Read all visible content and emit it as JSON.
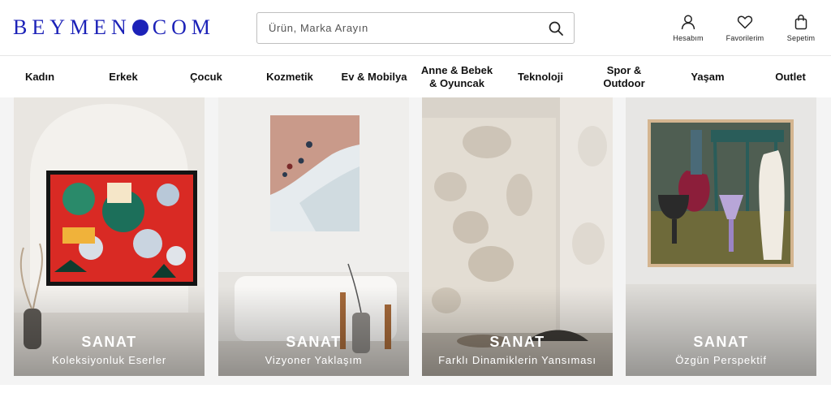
{
  "header": {
    "logo_text": {
      "left": "BEYMEN",
      "right": "COM"
    },
    "search": {
      "placeholder": "Ürün, Marka Arayın"
    },
    "actions": [
      {
        "label": "Hesabım",
        "icon": "user-icon"
      },
      {
        "label": "Favorilerim",
        "icon": "heart-icon"
      },
      {
        "label": "Sepetim",
        "icon": "shopping-bag-icon"
      }
    ]
  },
  "nav": {
    "items": [
      {
        "label": "Kadın"
      },
      {
        "label": "Erkek"
      },
      {
        "label": "Çocuk"
      },
      {
        "label": "Kozmetik"
      },
      {
        "label": "Ev & Mobilya"
      },
      {
        "label": "Anne & Bebek & Oyuncak"
      },
      {
        "label": "Teknoloji"
      },
      {
        "label": "Spor & Outdoor"
      },
      {
        "label": "Yaşam"
      },
      {
        "label": "Outlet"
      }
    ]
  },
  "cards": [
    {
      "title": "SANAT",
      "subtitle": "Koleksiyonluk Eserler"
    },
    {
      "title": "SANAT",
      "subtitle": "Vizyoner Yaklaşım"
    },
    {
      "title": "SANAT",
      "subtitle": "Farklı Dinamiklerin Yansıması"
    },
    {
      "title": "SANAT",
      "subtitle": "Özgün Perspektif"
    }
  ],
  "colors": {
    "brand": "#1c22b8",
    "text": "#111111",
    "border": "#bfbfbf"
  }
}
